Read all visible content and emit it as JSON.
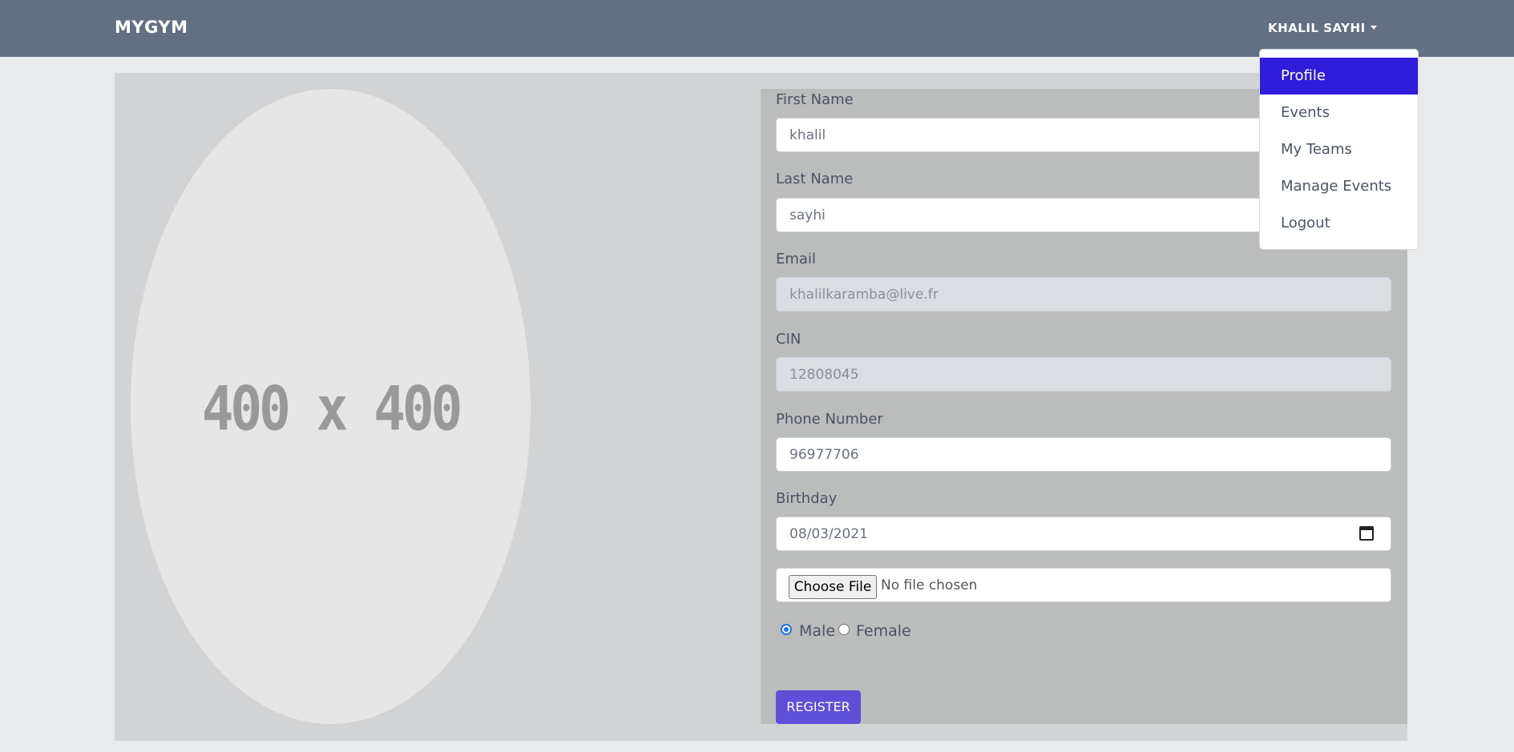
{
  "navbar": {
    "brand": "MYGYM",
    "user_menu_label": "KHALIL SAYHI",
    "dropdown_items": [
      {
        "label": "Profile",
        "active": true
      },
      {
        "label": "Events",
        "active": false
      },
      {
        "label": "My Teams",
        "active": false
      },
      {
        "label": "Manage Events",
        "active": false
      },
      {
        "label": "Logout",
        "active": false
      }
    ]
  },
  "avatar": {
    "placeholder_text": "400 x 400"
  },
  "form": {
    "first_name": {
      "label": "First Name",
      "value": "khalil"
    },
    "last_name": {
      "label": "Last Name",
      "value": "sayhi"
    },
    "email": {
      "label": "Email",
      "value": "khalilkaramba@live.fr",
      "disabled": true
    },
    "cin": {
      "label": "CIN",
      "value": "12808045",
      "disabled": true
    },
    "phone": {
      "label": "Phone Number",
      "value": "96977706"
    },
    "birthday": {
      "label": "Birthday",
      "value": "08/03/2021"
    },
    "file": {
      "button_label": "Choose File",
      "status": "No file chosen"
    },
    "gender": {
      "options": [
        "Male",
        "Female"
      ],
      "selected": "Male"
    },
    "submit_label": "REGISTER"
  },
  "colors": {
    "navbar": "#627084",
    "active_item": "#2f1ddb",
    "register_button": "#5e4ed8"
  }
}
